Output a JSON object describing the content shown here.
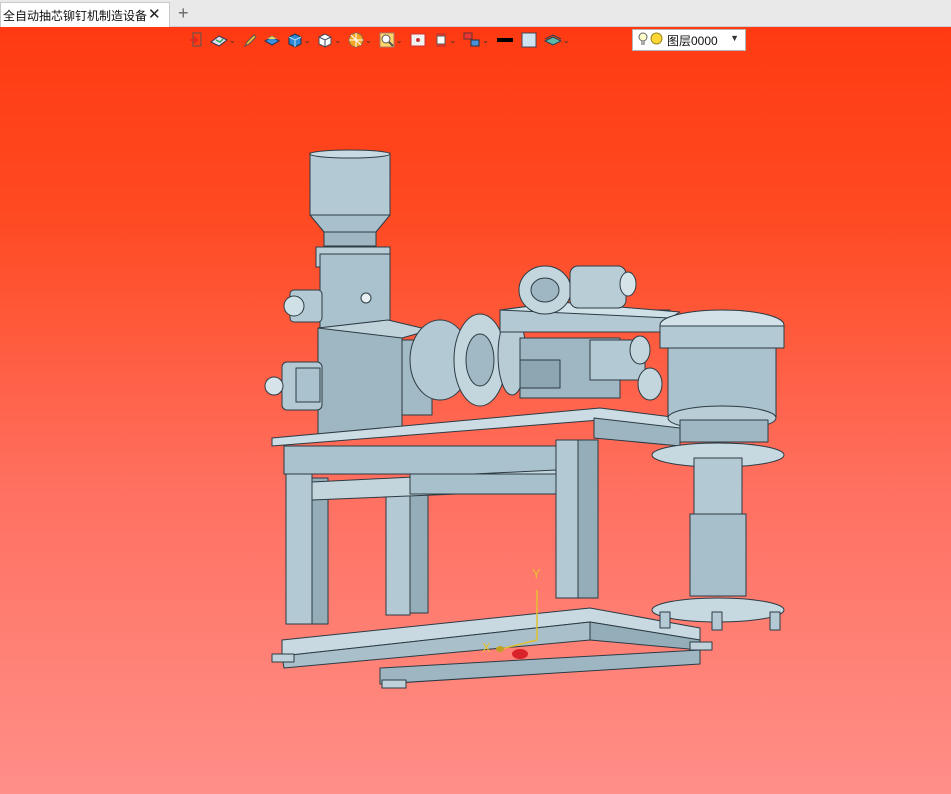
{
  "tab": {
    "title": "全自动抽芯铆钉机制造设备]",
    "close_icon": "close-icon",
    "add_icon": "plus-icon"
  },
  "toolbar": {
    "buttons": [
      "exit-sketch-icon",
      "view-direction-icon",
      "pencil-icon",
      "render-style-icon",
      "shaded-cube-icon",
      "white-cube-icon",
      "section-view-icon",
      "zoom-icon",
      "fit-view-icon",
      "align-view-icon",
      "display-settings-icon",
      "line-color-icon",
      "fill-color-icon",
      "layer-manager-icon"
    ],
    "layer_value": "图层0000",
    "colors": {
      "line": "#000000",
      "fill": "#cfe4f0"
    }
  },
  "axes": {
    "x_label": "X",
    "y_label": "Y"
  },
  "colors": {
    "background_top": "#ff3a12",
    "background_bottom": "#ff8f88",
    "model": "#a7c0cc",
    "model_edge": "#2c3b44"
  }
}
